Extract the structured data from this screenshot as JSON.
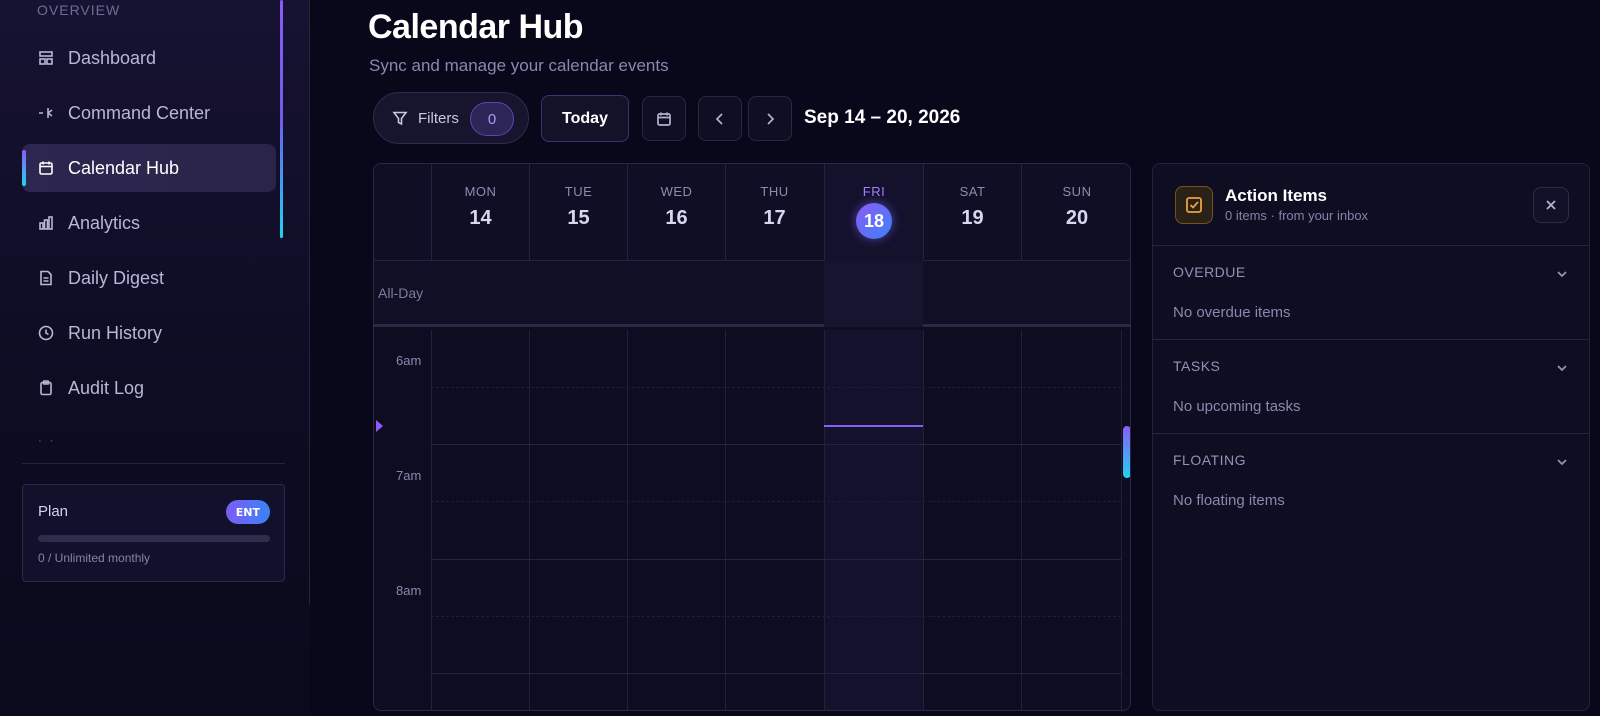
{
  "sidebar": {
    "section_label": "OVERVIEW",
    "items": [
      {
        "label": "Dashboard",
        "icon": "dashboard-icon",
        "active": false
      },
      {
        "label": "Command Center",
        "icon": "command-icon",
        "active": false
      },
      {
        "label": "Calendar Hub",
        "icon": "calendar-icon",
        "active": true
      },
      {
        "label": "Analytics",
        "icon": "chart-bar-icon",
        "active": false
      },
      {
        "label": "Daily Digest",
        "icon": "document-icon",
        "active": false
      },
      {
        "label": "Run History",
        "icon": "clock-icon",
        "active": false
      },
      {
        "label": "Audit Log",
        "icon": "clipboard-icon",
        "active": false
      }
    ],
    "plan": {
      "title": "Plan",
      "badge": "ENT",
      "usage_text": "0 / Unlimited monthly",
      "usage_fraction": 0
    }
  },
  "header": {
    "title": "Calendar Hub",
    "subtitle": "Sync and manage your calendar events"
  },
  "toolbar": {
    "filters_label": "Filters",
    "filters_count": "0",
    "today_label": "Today",
    "date_range": "Sep 14 – 20, 2026"
  },
  "calendar": {
    "days": [
      {
        "name": "MON",
        "num": "14",
        "today": false
      },
      {
        "name": "TUE",
        "num": "15",
        "today": false
      },
      {
        "name": "WED",
        "num": "16",
        "today": false
      },
      {
        "name": "THU",
        "num": "17",
        "today": false
      },
      {
        "name": "FRI",
        "num": "18",
        "today": true
      },
      {
        "name": "SAT",
        "num": "19",
        "today": false
      },
      {
        "name": "SUN",
        "num": "20",
        "today": false
      }
    ],
    "allday_label": "All-Day",
    "hours": [
      "6am",
      "7am",
      "8am"
    ]
  },
  "action_items": {
    "title": "Action Items",
    "subtitle": "0 items · from your inbox",
    "sections": [
      {
        "title": "OVERDUE",
        "empty_text": "No overdue items"
      },
      {
        "title": "TASKS",
        "empty_text": "No upcoming tasks"
      },
      {
        "title": "FLOATING",
        "empty_text": "No floating items"
      }
    ]
  },
  "colors": {
    "accent": "#8b5cf6",
    "accent_secondary": "#22d3ee",
    "background": "#08081a",
    "warning": "#f0a040"
  }
}
